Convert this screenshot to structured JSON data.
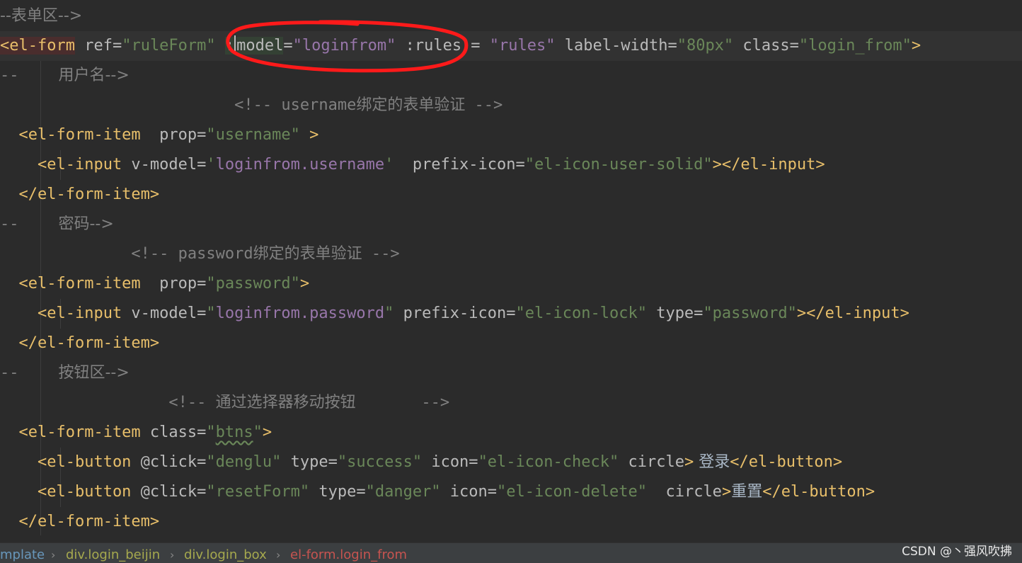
{
  "lines": [
    {
      "segments": [
        {
          "t": "--表单区-->",
          "c": "cmt cjk"
        }
      ]
    },
    {
      "current": true,
      "segments": [
        {
          "t": "<el-form",
          "c": "tag hl-tag"
        },
        {
          "t": " ref=",
          "c": "attr"
        },
        {
          "t": "\"ruleForm\"",
          "c": "str"
        },
        {
          "t": " ",
          "c": "attr"
        },
        {
          "t": ":",
          "c": "attr hl-attr"
        },
        {
          "caret": true
        },
        {
          "t": "model",
          "c": "attr hl-attr"
        },
        {
          "t": "=",
          "c": "attr"
        },
        {
          "t": "\"loginfrom\"",
          "c": "strp"
        },
        {
          "t": " :rules = ",
          "c": "attr"
        },
        {
          "t": "\"rules\"",
          "c": "strp"
        },
        {
          "t": " label-width=",
          "c": "attr"
        },
        {
          "t": "\"80px\"",
          "c": "str"
        },
        {
          "t": " class=",
          "c": "attr"
        },
        {
          "t": "\"login_from\"",
          "c": "str"
        },
        {
          "t": ">",
          "c": "tag"
        }
      ]
    },
    {
      "segments": [
        {
          "t": "--",
          "c": "cmt"
        },
        {
          "t": "        用户名-->",
          "c": "cmt cjk"
        }
      ]
    },
    {
      "segments": [
        {
          "t": "                         <!-- username绑定的表单验证 -->",
          "c": "cmt"
        }
      ]
    },
    {
      "segments": [
        {
          "t": "  <el-form-item",
          "c": "tag"
        },
        {
          "t": "  prop=",
          "c": "attr"
        },
        {
          "t": "\"username\"",
          "c": "str"
        },
        {
          "t": " >",
          "c": "tag"
        }
      ]
    },
    {
      "segments": [
        {
          "t": "    <el-input",
          "c": "tag"
        },
        {
          "t": " v-model=",
          "c": "attr"
        },
        {
          "t": "'",
          "c": "str"
        },
        {
          "t": "loginfrom.username",
          "c": "strp"
        },
        {
          "t": "'",
          "c": "str"
        },
        {
          "t": "  prefix-icon=",
          "c": "attr"
        },
        {
          "t": "\"el-icon-user-solid\"",
          "c": "str"
        },
        {
          "t": "></el-input>",
          "c": "tag"
        }
      ]
    },
    {
      "segments": [
        {
          "t": "  </el-form-item>",
          "c": "tag"
        }
      ]
    },
    {
      "segments": [
        {
          "t": "--",
          "c": "cmt"
        },
        {
          "t": "        密码-->",
          "c": "cmt cjk"
        }
      ]
    },
    {
      "segments": [
        {
          "t": "              <!-- password绑定的表单验证 -->",
          "c": "cmt"
        }
      ]
    },
    {
      "segments": [
        {
          "t": "  <el-form-item",
          "c": "tag"
        },
        {
          "t": "  prop=",
          "c": "attr"
        },
        {
          "t": "\"password\"",
          "c": "str"
        },
        {
          "t": ">",
          "c": "tag"
        }
      ]
    },
    {
      "segments": [
        {
          "t": "    <el-input",
          "c": "tag"
        },
        {
          "t": " v-model=",
          "c": "attr"
        },
        {
          "t": "\"",
          "c": "str"
        },
        {
          "t": "loginfrom.password",
          "c": "strp"
        },
        {
          "t": "\"",
          "c": "str"
        },
        {
          "t": " prefix-icon=",
          "c": "attr"
        },
        {
          "t": "\"el-icon-lock\"",
          "c": "str"
        },
        {
          "t": " type=",
          "c": "attr"
        },
        {
          "t": "\"password\"",
          "c": "str"
        },
        {
          "t": "></el-input>",
          "c": "tag"
        }
      ]
    },
    {
      "segments": [
        {
          "t": "  </el-form-item>",
          "c": "tag"
        }
      ]
    },
    {
      "segments": [
        {
          "t": "--",
          "c": "cmt"
        },
        {
          "t": "        按钮区-->",
          "c": "cmt cjk"
        }
      ]
    },
    {
      "segments": [
        {
          "t": "                  <!-- 通过选择器移动按钮       -->",
          "c": "cmt"
        }
      ]
    },
    {
      "segments": [
        {
          "t": "  <el-form-item",
          "c": "tag"
        },
        {
          "t": " class=",
          "c": "attr"
        },
        {
          "t": "\"",
          "c": "str"
        },
        {
          "t": "btns",
          "c": "str squiggle"
        },
        {
          "t": "\"",
          "c": "str"
        },
        {
          "t": ">",
          "c": "tag"
        }
      ]
    },
    {
      "segments": [
        {
          "t": "    <el-button",
          "c": "tag"
        },
        {
          "t": " @click=",
          "c": "attr"
        },
        {
          "t": "\"denglu\"",
          "c": "str"
        },
        {
          "t": " type=",
          "c": "attr"
        },
        {
          "t": "\"success\"",
          "c": "str"
        },
        {
          "t": " icon=",
          "c": "attr"
        },
        {
          "t": "\"el-icon-check\"",
          "c": "str"
        },
        {
          "t": " circle",
          "c": "attr"
        },
        {
          "t": ">",
          "c": "tag"
        },
        {
          "t": " 登录",
          "c": "punct cjk"
        },
        {
          "t": "</el-button>",
          "c": "tag"
        }
      ]
    },
    {
      "segments": [
        {
          "t": "    <el-button",
          "c": "tag"
        },
        {
          "t": " @click=",
          "c": "attr"
        },
        {
          "t": "\"resetForm\"",
          "c": "str"
        },
        {
          "t": " type=",
          "c": "attr"
        },
        {
          "t": "\"danger\"",
          "c": "str"
        },
        {
          "t": " icon=",
          "c": "attr"
        },
        {
          "t": "\"el-icon-delete\"",
          "c": "str"
        },
        {
          "t": "  circle",
          "c": "attr"
        },
        {
          "t": ">",
          "c": "tag"
        },
        {
          "t": "重置",
          "c": "punct cjk"
        },
        {
          "t": "</el-button>",
          "c": "tag"
        }
      ]
    },
    {
      "segments": [
        {
          "t": "  </el-form-item>",
          "c": "tag"
        }
      ]
    }
  ],
  "breadcrumb": [
    "mplate",
    "div.login_beijin",
    "div.login_box",
    "el-form.login_from"
  ],
  "breadcrumb_separator": "›",
  "watermark": "CSDN @丶强风吹拂",
  "colors": {
    "background": "#2b2b2b",
    "tag": "#e8bf6a",
    "string": "#6a8759",
    "string_purple": "#9876aa",
    "comment": "#808080",
    "annotation_circle": "#ff1a1a"
  }
}
